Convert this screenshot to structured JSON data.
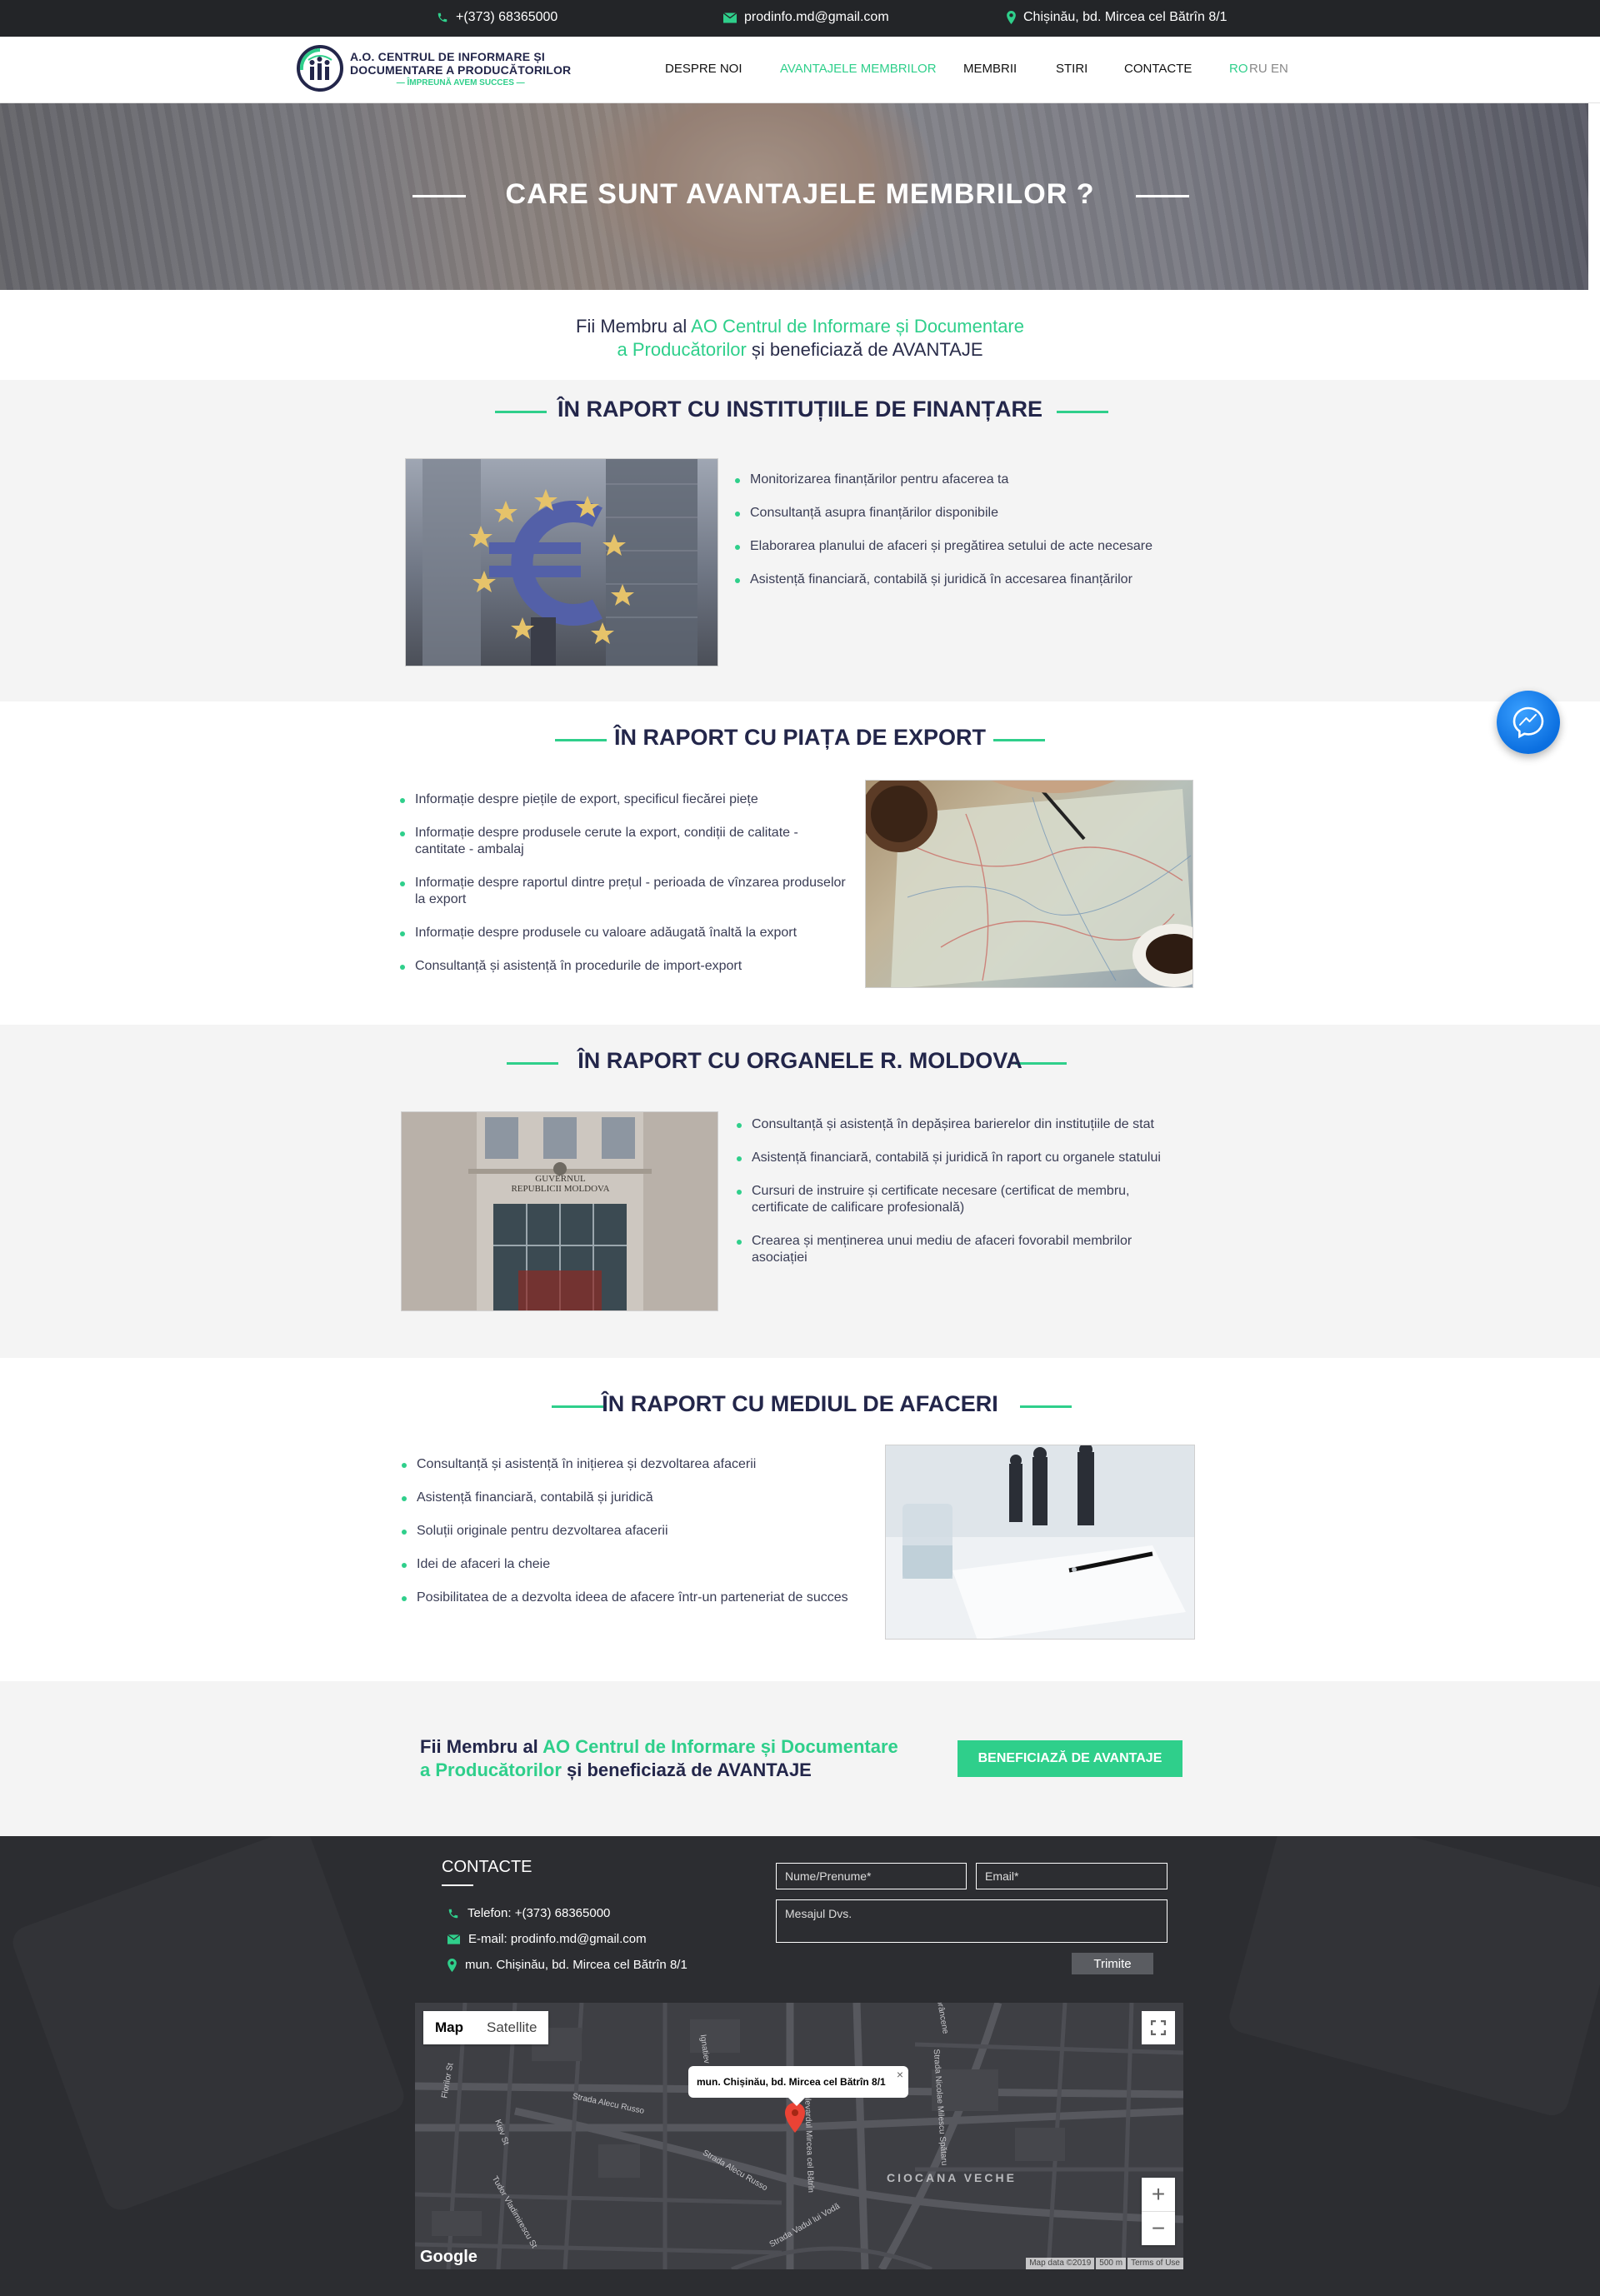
{
  "topbar": {
    "phone": "+(373) 68365000",
    "email": "prodinfo.md@gmail.com",
    "address": "Chișinău, bd. Mircea cel Bătrîn 8/1"
  },
  "logo": {
    "line1": "A.O. CENTRUL DE INFORMARE ȘI",
    "line2": "DOCUMENTARE A PRODUCĂTORILOR",
    "slogan": "— ÎMPREUNĂ AVEM SUCCES —"
  },
  "nav": {
    "items": [
      {
        "label": "DESPRE NOI"
      },
      {
        "label": "AVANTAJELE MEMBRILOR"
      },
      {
        "label": "MEMBRII"
      },
      {
        "label": "STIRI"
      },
      {
        "label": "CONTACTE"
      }
    ],
    "languages": [
      "RO",
      "RU",
      "EN"
    ]
  },
  "hero": {
    "title": "CARE SUNT AVANTAJELE MEMBRILOR ?"
  },
  "intro": {
    "part1": "Fii Membru al ",
    "highlight1": "AO Centrul de Informare și Documentare",
    "highlight2": "a Producătorilor",
    "part2": " și beneficiază de AVANTAJE"
  },
  "sections": [
    {
      "title": "ÎN RAPORT CU INSTITUȚIILE DE FINANȚARE",
      "items": [
        "Monitorizarea finanțărilor pentru afacerea ta",
        "Consultanță asupra finanțărilor disponibile",
        "Elaborarea planului de afaceri și pregătirea setului de acte necesare",
        "Asistență financiară, contabilă și juridică în accesarea finanțărilor"
      ]
    },
    {
      "title": "ÎN RAPORT CU PIAȚA DE EXPORT",
      "items": [
        "Informație despre piețile de export, specificul fiecărei piețe",
        "Informație despre produsele cerute la export, condiții de calitate - cantitate - ambalaj",
        "Informație despre raportul dintre prețul - perioada de vînzarea produselor la export",
        "Informație despre produsele cu valoare adăugată înaltă la export",
        "Consultanță și asistență în procedurile de import-export"
      ]
    },
    {
      "title": "ÎN RAPORT CU ORGANELE R. MOLDOVA",
      "building_sign": "GUVERNUL\nREPUBLICII MOLDOVA",
      "items": [
        "Consultanță și asistență în depășirea barierelor din instituțiile de stat",
        "Asistență financiară, contabilă și juridică în raport cu organele statului",
        "Cursuri de instruire și certificate necesare (certificat de membru, certificate de calificare profesională)",
        "Crearea și menținerea unui mediu de afaceri fovorabil membrilor asociației"
      ]
    },
    {
      "title": "ÎN RAPORT CU MEDIUL DE AFACERI",
      "items": [
        "Consultanță și asistență în inițierea și dezvoltarea afacerii",
        "Asistență financiară, contabilă și juridică",
        "Soluții originale pentru dezvoltarea afacerii",
        "Idei de afaceri la cheie",
        "Posibilitatea de a dezvolta ideea de afacere într-un parteneriat de succes"
      ]
    }
  ],
  "cta": {
    "part1": "Fii Membru al ",
    "highlight1": "AO Centrul de Informare și Documentare",
    "highlight2": "a Producătorilor",
    "part2": " și beneficiază de AVANTAJE",
    "button": "BENEFICIAZĂ DE AVANTAJE"
  },
  "footer": {
    "title": "CONTACTE",
    "phone": "Telefon: +(373) 68365000",
    "email": "E-mail: prodinfo.md@gmail.com",
    "address": "mun. Chișinău, bd. Mircea cel Bătrîn 8/1",
    "form": {
      "name_placeholder": "Nume/Prenume*",
      "email_placeholder": "Email*",
      "message_placeholder": "Mesajul Dvs.",
      "submit": "Trimite"
    }
  },
  "map": {
    "tab_map": "Map",
    "tab_satellite": "Satellite",
    "popup": "mun. Chișinău, bd. Mircea cel Bătrîn 8/1",
    "district": "CIOCANA VECHE",
    "streets": [
      "Strada Alecu Russo",
      "Strada Alecu Russo",
      "Bulevardul Mircea cel Bătrîn",
      "Strada Vadul lui Vodă",
      "Strada Nicolae Milescu Spătaru",
      "Kiev St",
      "Tudor Vladimirescu St",
      "Florilor St",
      "Sprâncene",
      "Ignatiev"
    ],
    "zoom_in": "+",
    "zoom_out": "−",
    "google": "Google",
    "attribution": [
      "Map data ©2019",
      "500 m",
      "Terms of Use"
    ]
  },
  "colors": {
    "accent": "#2fcf8b",
    "navy": "#23264a",
    "topbar": "#232528",
    "footer": "#2c2d31"
  }
}
